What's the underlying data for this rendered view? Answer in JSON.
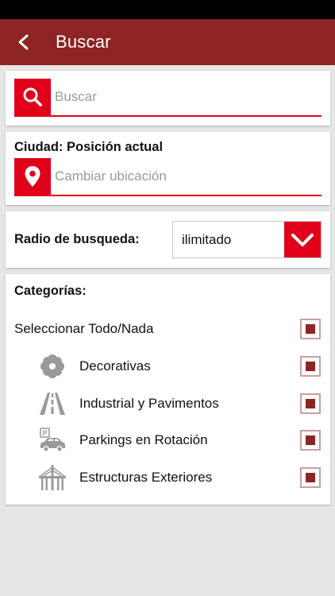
{
  "app_bar": {
    "title": "Buscar",
    "back_icon": "arrow-left-icon"
  },
  "search": {
    "placeholder": "Buscar",
    "value": "",
    "icon": "search-icon"
  },
  "city": {
    "label": "Ciudad: Posición actual",
    "placeholder": "Cambiar ubicación",
    "value": "",
    "icon": "location-pin-icon"
  },
  "radius": {
    "label": "Radio de busqueda:",
    "selected": "ilimitado",
    "icon": "chevron-down-icon"
  },
  "categories": {
    "title": "Categorías:",
    "select_all": {
      "label": "Seleccionar Todo/Nada",
      "checked": true
    },
    "items": [
      {
        "label": "Decorativas",
        "icon": "flower-icon",
        "checked": true
      },
      {
        "label": "Industrial y Pavimentos",
        "icon": "road-icon",
        "checked": true
      },
      {
        "label": "Parkings en Rotación",
        "icon": "parking-car-icon",
        "checked": true
      },
      {
        "label": "Estructuras Exteriores",
        "icon": "bridge-icon",
        "checked": true
      }
    ]
  },
  "colors": {
    "primary_dark": "#8e2424",
    "accent_red": "#e1001a",
    "background": "#e6e6e6",
    "icon_gray": "#9a9a9a"
  }
}
